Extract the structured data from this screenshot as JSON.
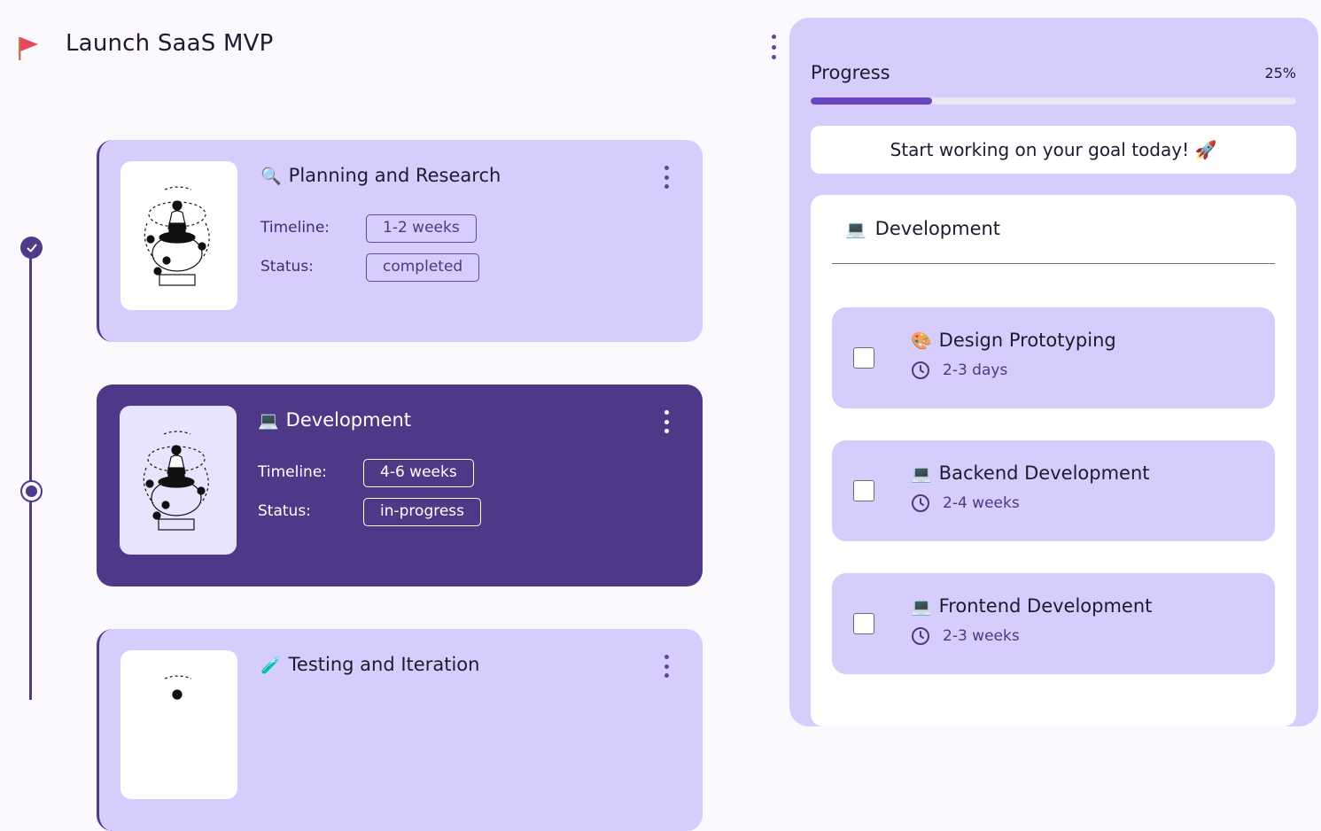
{
  "header": {
    "title": "Launch SaaS MVP",
    "flag_color": "#e8465b"
  },
  "timeline_labels": {
    "timeline": "Timeline:",
    "status": "Status:"
  },
  "milestones": [
    {
      "emoji": "🔍",
      "title": "Planning and Research",
      "timeline": "1-2 weeks",
      "status": "completed"
    },
    {
      "emoji": "💻",
      "title": "Development",
      "timeline": "4-6 weeks",
      "status": "in-progress"
    },
    {
      "emoji": "🧪",
      "title": "Testing and Iteration"
    }
  ],
  "progress": {
    "label": "Progress",
    "percent_text": "25%",
    "value": 0.25
  },
  "motivation": "Start working on your goal today! 🚀",
  "current_section": {
    "emoji": "💻",
    "title": "Development",
    "tasks": [
      {
        "emoji": "🎨",
        "title": "Design Prototyping",
        "duration": "2-3 days",
        "checked": false
      },
      {
        "emoji": "💻",
        "title": "Backend Development",
        "duration": "2-4 weeks",
        "checked": false
      },
      {
        "emoji": "💻",
        "title": "Frontend Development",
        "duration": "2-3 weeks",
        "checked": false
      }
    ]
  },
  "colors": {
    "accent": "#4f3a8a",
    "card_light": "#d7cdfd",
    "card_dark": "#4f3888",
    "progress_fill": "#6a47c0"
  }
}
